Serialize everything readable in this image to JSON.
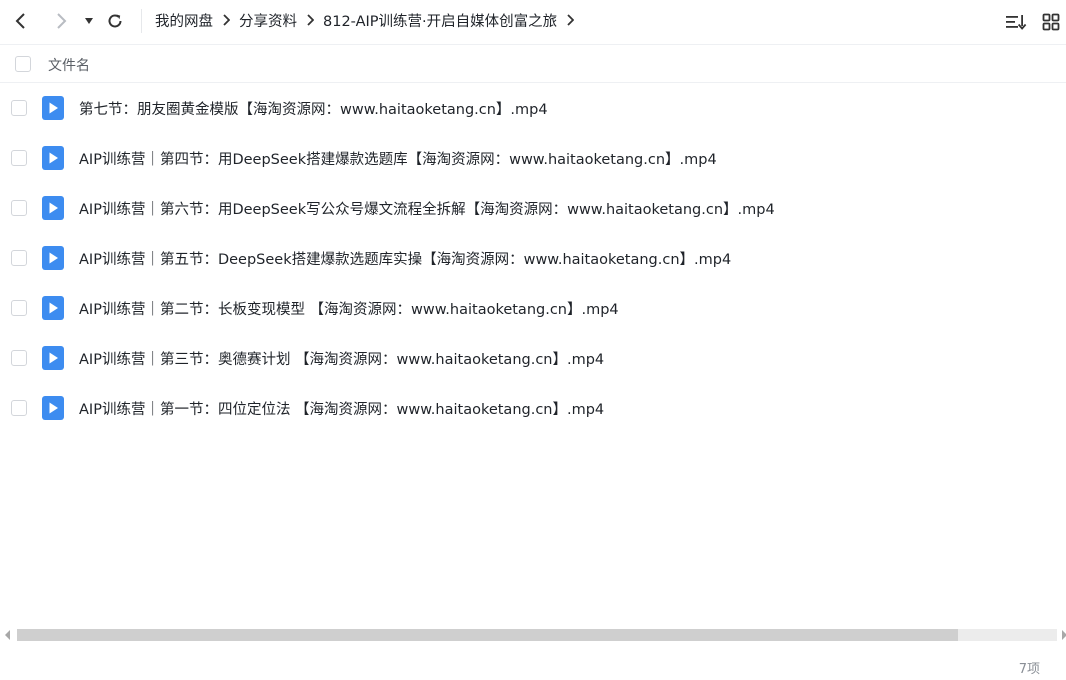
{
  "toolbar": {
    "back_icon": "chevron-left-icon",
    "forward_icon": "chevron-right-icon",
    "history_icon": "caret-down-icon",
    "refresh_icon": "refresh-icon",
    "sort_icon": "sort-icon",
    "grid_icon": "grid-view-icon"
  },
  "breadcrumb": [
    {
      "label": "我的网盘"
    },
    {
      "label": "分享资料"
    },
    {
      "label": "812-AIP训练营·开启自媒体创富之旅"
    }
  ],
  "list": {
    "header_label": "文件名",
    "files": [
      {
        "name": "第七节：朋友圈黄金模版【海淘资源网：www.haitaoketang.cn】.mp4"
      },
      {
        "name": "AIP训练营｜第四节：用DeepSeek搭建爆款选题库【海淘资源网：www.haitaoketang.cn】.mp4"
      },
      {
        "name": "AIP训练营｜第六节：用DeepSeek写公众号爆文流程全拆解【海淘资源网：www.haitaoketang.cn】.mp4"
      },
      {
        "name": "AIP训练营｜第五节：DeepSeek搭建爆款选题库实操【海淘资源网：www.haitaoketang.cn】.mp4"
      },
      {
        "name": "AIP训练营｜第二节：长板变现模型 【海淘资源网：www.haitaoketang.cn】.mp4"
      },
      {
        "name": "AIP训练营｜第三节：奥德赛计划 【海淘资源网：www.haitaoketang.cn】.mp4"
      },
      {
        "name": "AIP训练营｜第一节：四位定位法 【海淘资源网：www.haitaoketang.cn】.mp4"
      }
    ]
  },
  "scrollbar": {
    "thumb_fraction": 0.905
  },
  "footer": {
    "item_count": "7项"
  },
  "colors": {
    "video_icon": "#3d8cf0",
    "text": "#1f2329",
    "muted": "#8a8f96"
  }
}
